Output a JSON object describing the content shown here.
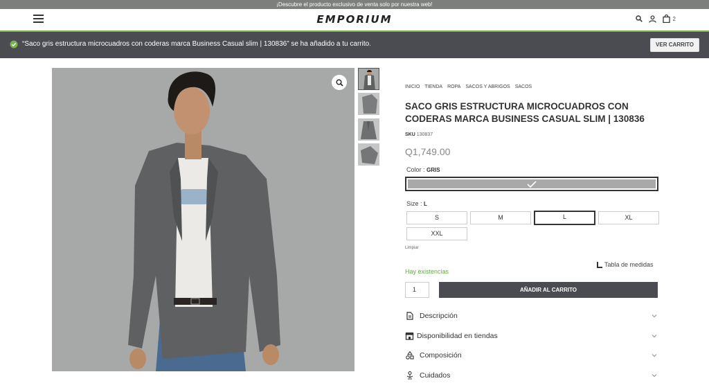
{
  "promo": {
    "text": "¡Descubre el producto exclusivo de venta solo por nuestra web!"
  },
  "header": {
    "logo": "EMPORIUM",
    "cart_count": "2"
  },
  "notice": {
    "message": "“Saco gris estructura microcuadros con coderas marca Business Casual slim | 130836” se ha añadido a tu carrito.",
    "button_label": "VER CARRITO"
  },
  "breadcrumb": [
    "INICIO",
    "TIENDA",
    "ROPA",
    "SACOS Y ABRIGOS",
    "SACOS"
  ],
  "product": {
    "title": "SACO GRIS ESTRUCTURA MICROCUADROS CON CODERAS MARCA BUSINESS CASUAL SLIM | 130836",
    "sku_label": "SKU",
    "sku_value": "130837",
    "price": "Q1,749.00"
  },
  "color": {
    "label": "Color : ",
    "value": "GRIS",
    "swatch_hex": "#a9a9a9"
  },
  "size": {
    "label": "Size : ",
    "value": "L",
    "options": [
      "S",
      "M",
      "L",
      "XL",
      "XXL"
    ],
    "clear_label": "Limpiar"
  },
  "stock": {
    "text": "Hay existencias",
    "color_hex": "#6aa84f"
  },
  "size_chart": {
    "label": "Tabla de medidas"
  },
  "cart": {
    "quantity": "1",
    "add_label": "AÑADIR AL CARRITO"
  },
  "accordion": [
    {
      "label": "Descripción",
      "icon": "document-icon"
    },
    {
      "label": "Disponibilidad en tiendas",
      "icon": "store-icon"
    },
    {
      "label": "Composición",
      "icon": "shapes-icon"
    },
    {
      "label": "Cuidados",
      "icon": "care-icon"
    }
  ],
  "colors": {
    "header_dark": "#4a4c51",
    "accent_green": "#78b44a"
  }
}
